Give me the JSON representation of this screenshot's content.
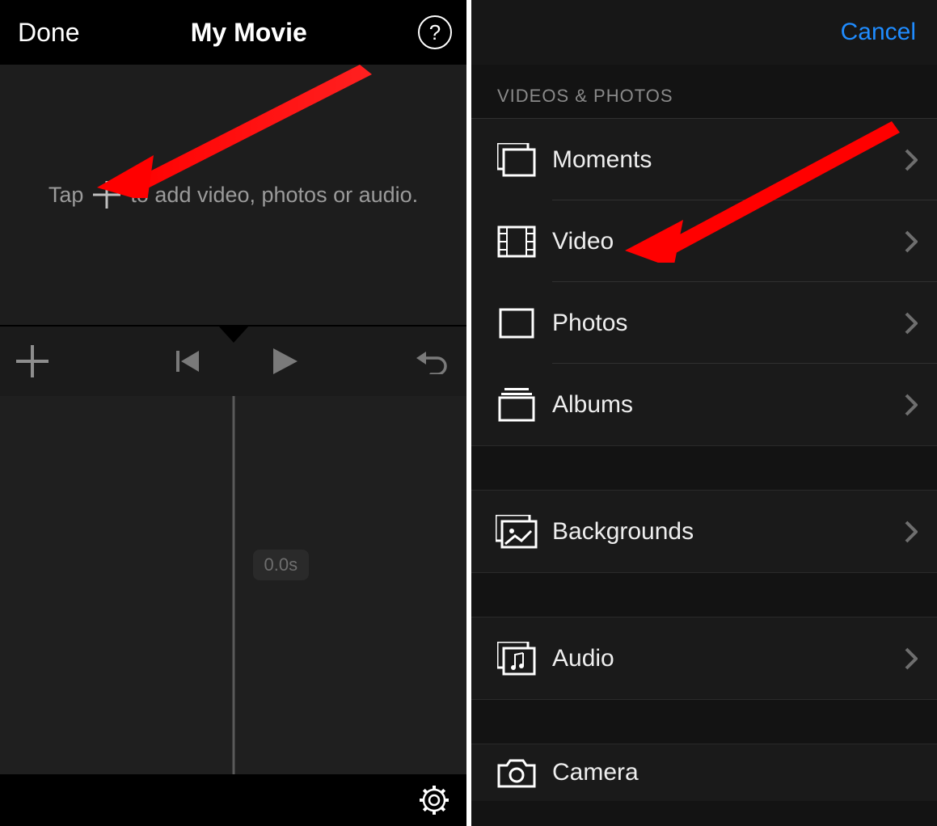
{
  "left": {
    "done": "Done",
    "title": "My Movie",
    "help": "?",
    "hint_pre": "Tap",
    "hint_post": "to add video, photos or audio.",
    "time_chip": "0.0s"
  },
  "right": {
    "cancel": "Cancel",
    "section_header": "VIDEOS & PHOTOS",
    "rows": {
      "moments": "Moments",
      "video": "Video",
      "photos": "Photos",
      "albums": "Albums",
      "backgrounds": "Backgrounds",
      "audio": "Audio",
      "camera": "Camera"
    }
  }
}
